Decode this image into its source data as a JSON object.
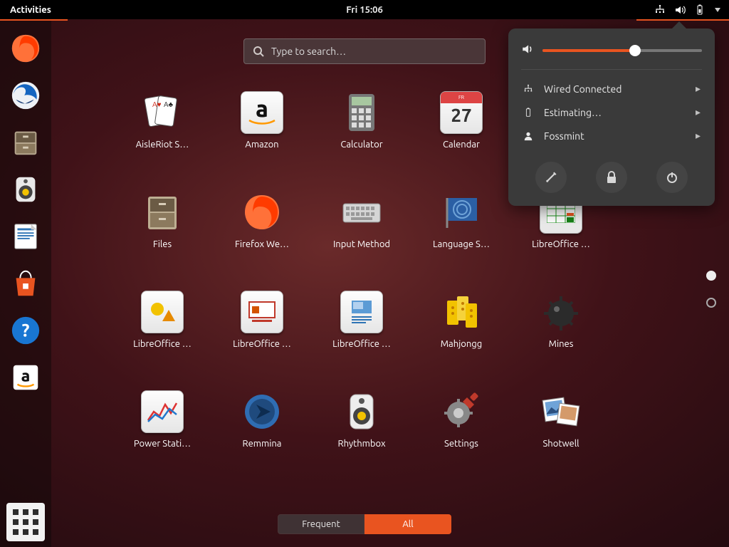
{
  "topbar": {
    "activities_label": "Activities",
    "clock": "Fri 15:06"
  },
  "search": {
    "placeholder": "Type to search…"
  },
  "tabs": {
    "frequent": "Frequent",
    "all": "All",
    "active": "all"
  },
  "dock": [
    {
      "name": "firefox"
    },
    {
      "name": "thunderbird"
    },
    {
      "name": "files"
    },
    {
      "name": "rhythmbox"
    },
    {
      "name": "libreoffice-writer"
    },
    {
      "name": "ubuntu-software"
    },
    {
      "name": "help"
    },
    {
      "name": "amazon"
    }
  ],
  "apps": [
    {
      "label": "AisleRiot S…",
      "name": "aisleriot"
    },
    {
      "label": "Amazon",
      "name": "amazon"
    },
    {
      "label": "Calculator",
      "name": "calculator"
    },
    {
      "label": "Calendar",
      "name": "calendar"
    },
    {
      "label": "Files",
      "name": "files"
    },
    {
      "label": "Firefox We…",
      "name": "firefox"
    },
    {
      "label": "Input Method",
      "name": "input-method"
    },
    {
      "label": "Language S…",
      "name": "language-support"
    },
    {
      "label": "LibreOffice …",
      "name": "libreoffice-calc"
    },
    {
      "label": "LibreOffice …",
      "name": "libreoffice-draw"
    },
    {
      "label": "LibreOffice …",
      "name": "libreoffice-impress"
    },
    {
      "label": "LibreOffice …",
      "name": "libreoffice-writer"
    },
    {
      "label": "Mahjongg",
      "name": "mahjongg"
    },
    {
      "label": "Mines",
      "name": "mines"
    },
    {
      "label": "Power Stati…",
      "name": "power-statistics"
    },
    {
      "label": "Remmina",
      "name": "remmina"
    },
    {
      "label": "Rhythmbox",
      "name": "rhythmbox"
    },
    {
      "label": "Settings",
      "name": "settings"
    },
    {
      "label": "Shotwell",
      "name": "shotwell"
    }
  ],
  "calendar_day": "27",
  "system_menu": {
    "volume_percent": 58,
    "items": [
      {
        "icon": "network",
        "label": "Wired Connected"
      },
      {
        "icon": "battery",
        "label": "Estimating…"
      },
      {
        "icon": "user",
        "label": "Fossmint"
      }
    ],
    "actions": [
      "settings",
      "lock",
      "power"
    ]
  }
}
